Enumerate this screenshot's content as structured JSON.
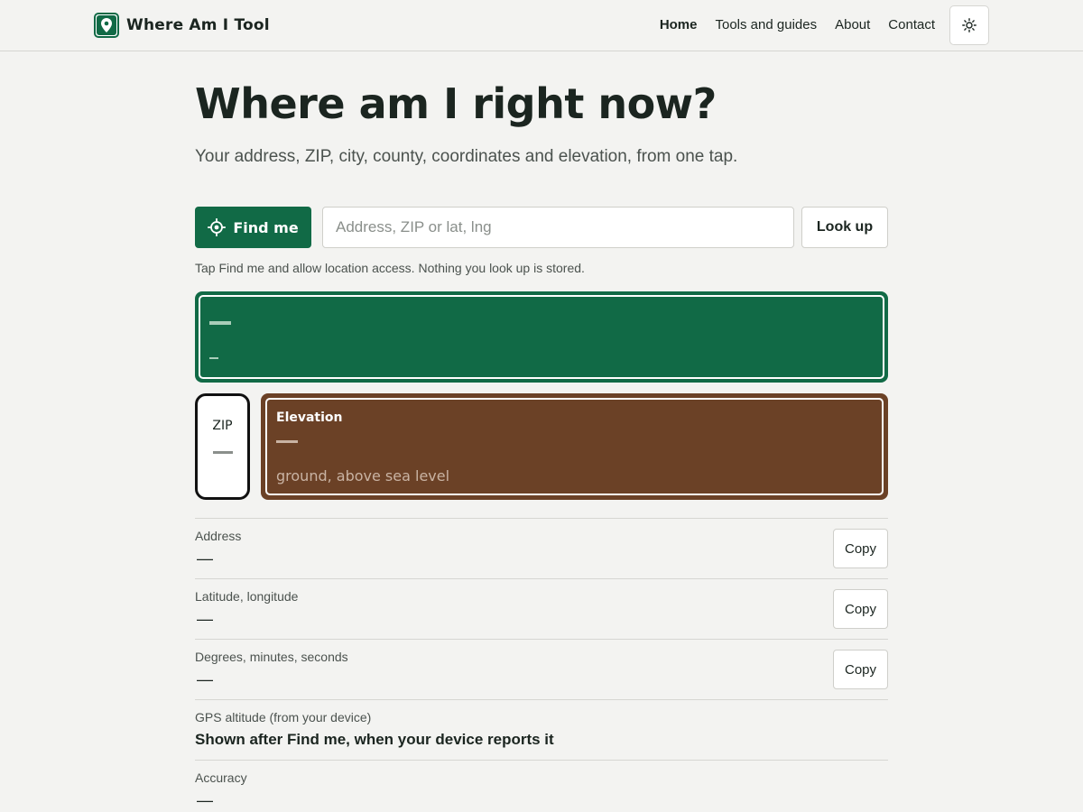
{
  "header": {
    "brand_name": "Where Am I Tool",
    "logo_icon": "map-pin-icon",
    "nav": [
      {
        "label": "Home",
        "active": true
      },
      {
        "label": "Tools and guides",
        "active": false
      },
      {
        "label": "About",
        "active": false
      },
      {
        "label": "Contact",
        "active": false
      }
    ],
    "theme_toggle_icon": "sun-icon"
  },
  "hero": {
    "title": "Where am I right now?",
    "subtitle": "Your address, ZIP, city, county, coordinates and elevation, from one tap."
  },
  "locate": {
    "find_me_label": "Find me",
    "find_me_icon": "crosshair-icon",
    "search_value": "",
    "search_placeholder": "Address, ZIP or lat, lng",
    "lookup_label": "Look up",
    "hint": "Tap Find me and allow location access. Nothing you look up is stored."
  },
  "cards": {
    "zip_label": "ZIP",
    "elevation_title": "Elevation",
    "elevation_unit": "ground, above sea level"
  },
  "details": [
    {
      "label": "Address",
      "value": "—",
      "copy_label": "Copy"
    },
    {
      "label": "Latitude, longitude",
      "value": "—",
      "copy_label": "Copy"
    },
    {
      "label": "Degrees, minutes, seconds",
      "value": "—",
      "copy_label": "Copy"
    },
    {
      "label": "GPS altitude (from your device)",
      "value": "Shown after Find me, when your device reports it"
    },
    {
      "label": "Accuracy",
      "value": "—"
    }
  ],
  "colors": {
    "brand_green": "#116a46",
    "elevation_brown": "#6b4126",
    "background": "#f3f3f1"
  }
}
